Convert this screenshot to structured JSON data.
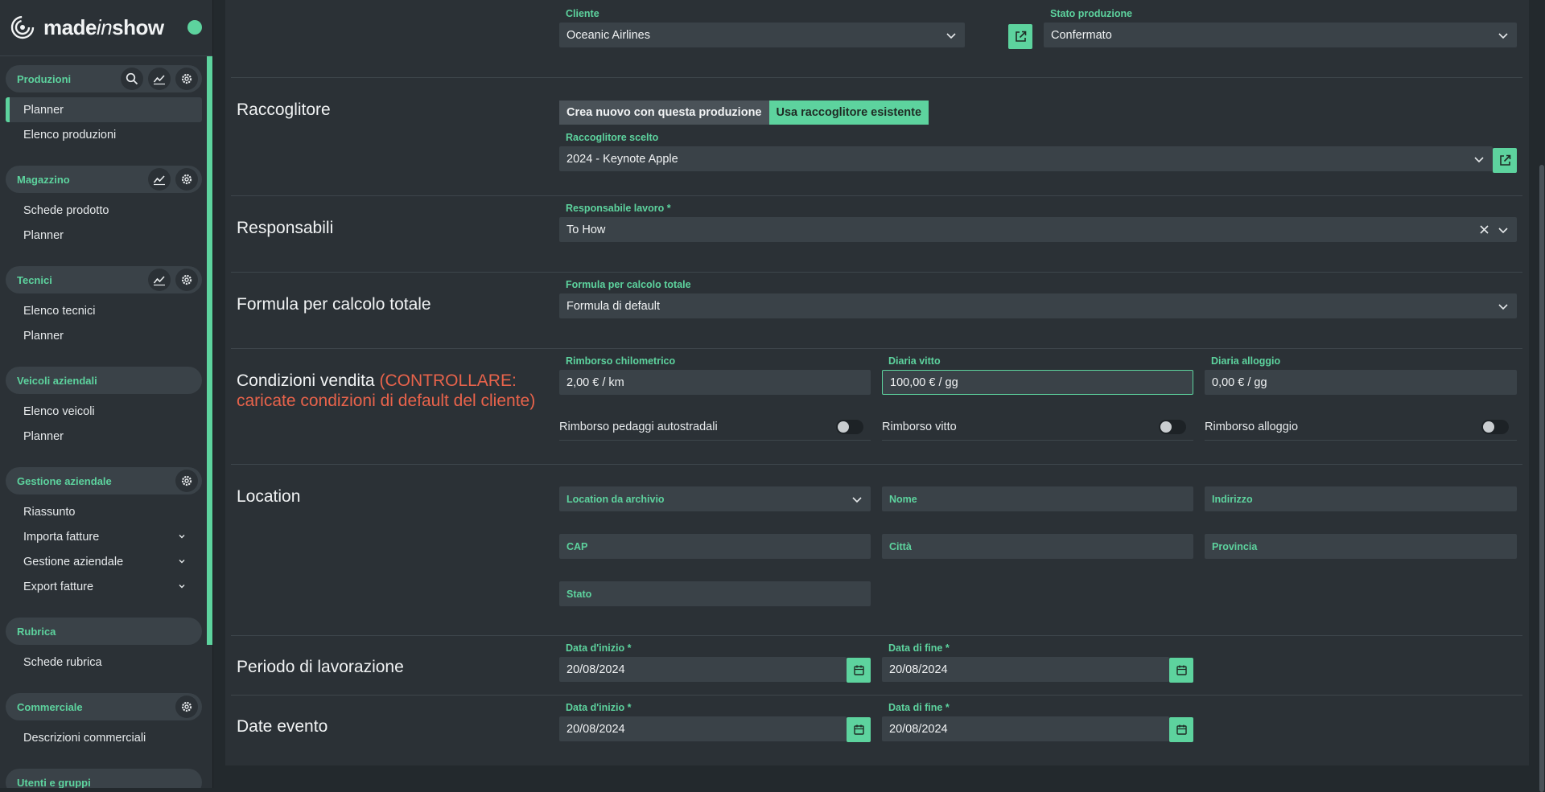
{
  "brand": {
    "name_a": "made",
    "name_b": "in",
    "name_c": "show"
  },
  "sidebar": {
    "groups": [
      {
        "title": "Produzioni",
        "items": [
          "Planner",
          "Elenco produzioni"
        ]
      },
      {
        "title": "Magazzino",
        "items": [
          "Schede prodotto",
          "Planner"
        ]
      },
      {
        "title": "Tecnici",
        "items": [
          "Elenco tecnici",
          "Planner"
        ]
      },
      {
        "title": "Veicoli aziendali",
        "items": [
          "Elenco veicoli",
          "Planner"
        ]
      },
      {
        "title": "Gestione aziendale",
        "items": [
          "Riassunto",
          "Importa fatture",
          "Gestione aziendale",
          "Export fatture"
        ]
      },
      {
        "title": "Rubrica",
        "items": [
          "Schede rubrica"
        ]
      },
      {
        "title": "Commerciale",
        "items": [
          "Descrizioni commerciali"
        ]
      },
      {
        "title": "Utenti e gruppi",
        "items": []
      }
    ],
    "active_item": "Planner"
  },
  "top": {
    "cliente_label": "Cliente",
    "cliente_value": "Oceanic Airlines",
    "stato_label": "Stato produzione",
    "stato_value": "Confermato"
  },
  "raccoglitore": {
    "title": "Raccoglitore",
    "option_new": "Crea nuovo con questa produzione",
    "option_existing": "Usa raccoglitore esistente",
    "selected_label": "Raccoglitore scelto",
    "selected_value": "2024 - Keynote Apple"
  },
  "responsabili": {
    "title": "Responsabili",
    "label": "Responsabile lavoro *",
    "value": "To How"
  },
  "formula": {
    "title": "Formula per calcolo totale",
    "label": "Formula per calcolo totale",
    "value": "Formula di default"
  },
  "condizioni": {
    "title": "Condizioni vendita",
    "warning": "(CONTROLLARE: caricate condizioni di default del cliente)",
    "km_label": "Rimborso chilometrico",
    "km_value": "2,00 € / km",
    "vitto_label": "Diaria vitto",
    "vitto_value": "100,00 € / gg",
    "alloggio_label": "Diaria alloggio",
    "alloggio_value": "0,00 € / gg",
    "toggle_pedaggi": "Rimborso pedaggi autostradali",
    "toggle_vitto": "Rimborso vitto",
    "toggle_alloggio": "Rimborso alloggio"
  },
  "location": {
    "title": "Location",
    "archivio": "Location da archivio",
    "nome": "Nome",
    "indirizzo": "Indirizzo",
    "cap": "CAP",
    "citta": "Città",
    "provincia": "Provincia",
    "stato": "Stato"
  },
  "periodo": {
    "title": "Periodo di lavorazione",
    "start_label": "Data d'inizio *",
    "start_value": "20/08/2024",
    "end_label": "Data di fine *",
    "end_value": "20/08/2024"
  },
  "evento": {
    "title": "Date evento",
    "start_label": "Data d'inizio *",
    "start_value": "20/08/2024",
    "end_label": "Data di fine *",
    "end_value": "20/08/2024"
  },
  "colors": {
    "accent": "#5dd39e",
    "warning": "#e8634b",
    "background": "#23292d",
    "panel": "#2b3136",
    "field": "#3a4248"
  }
}
